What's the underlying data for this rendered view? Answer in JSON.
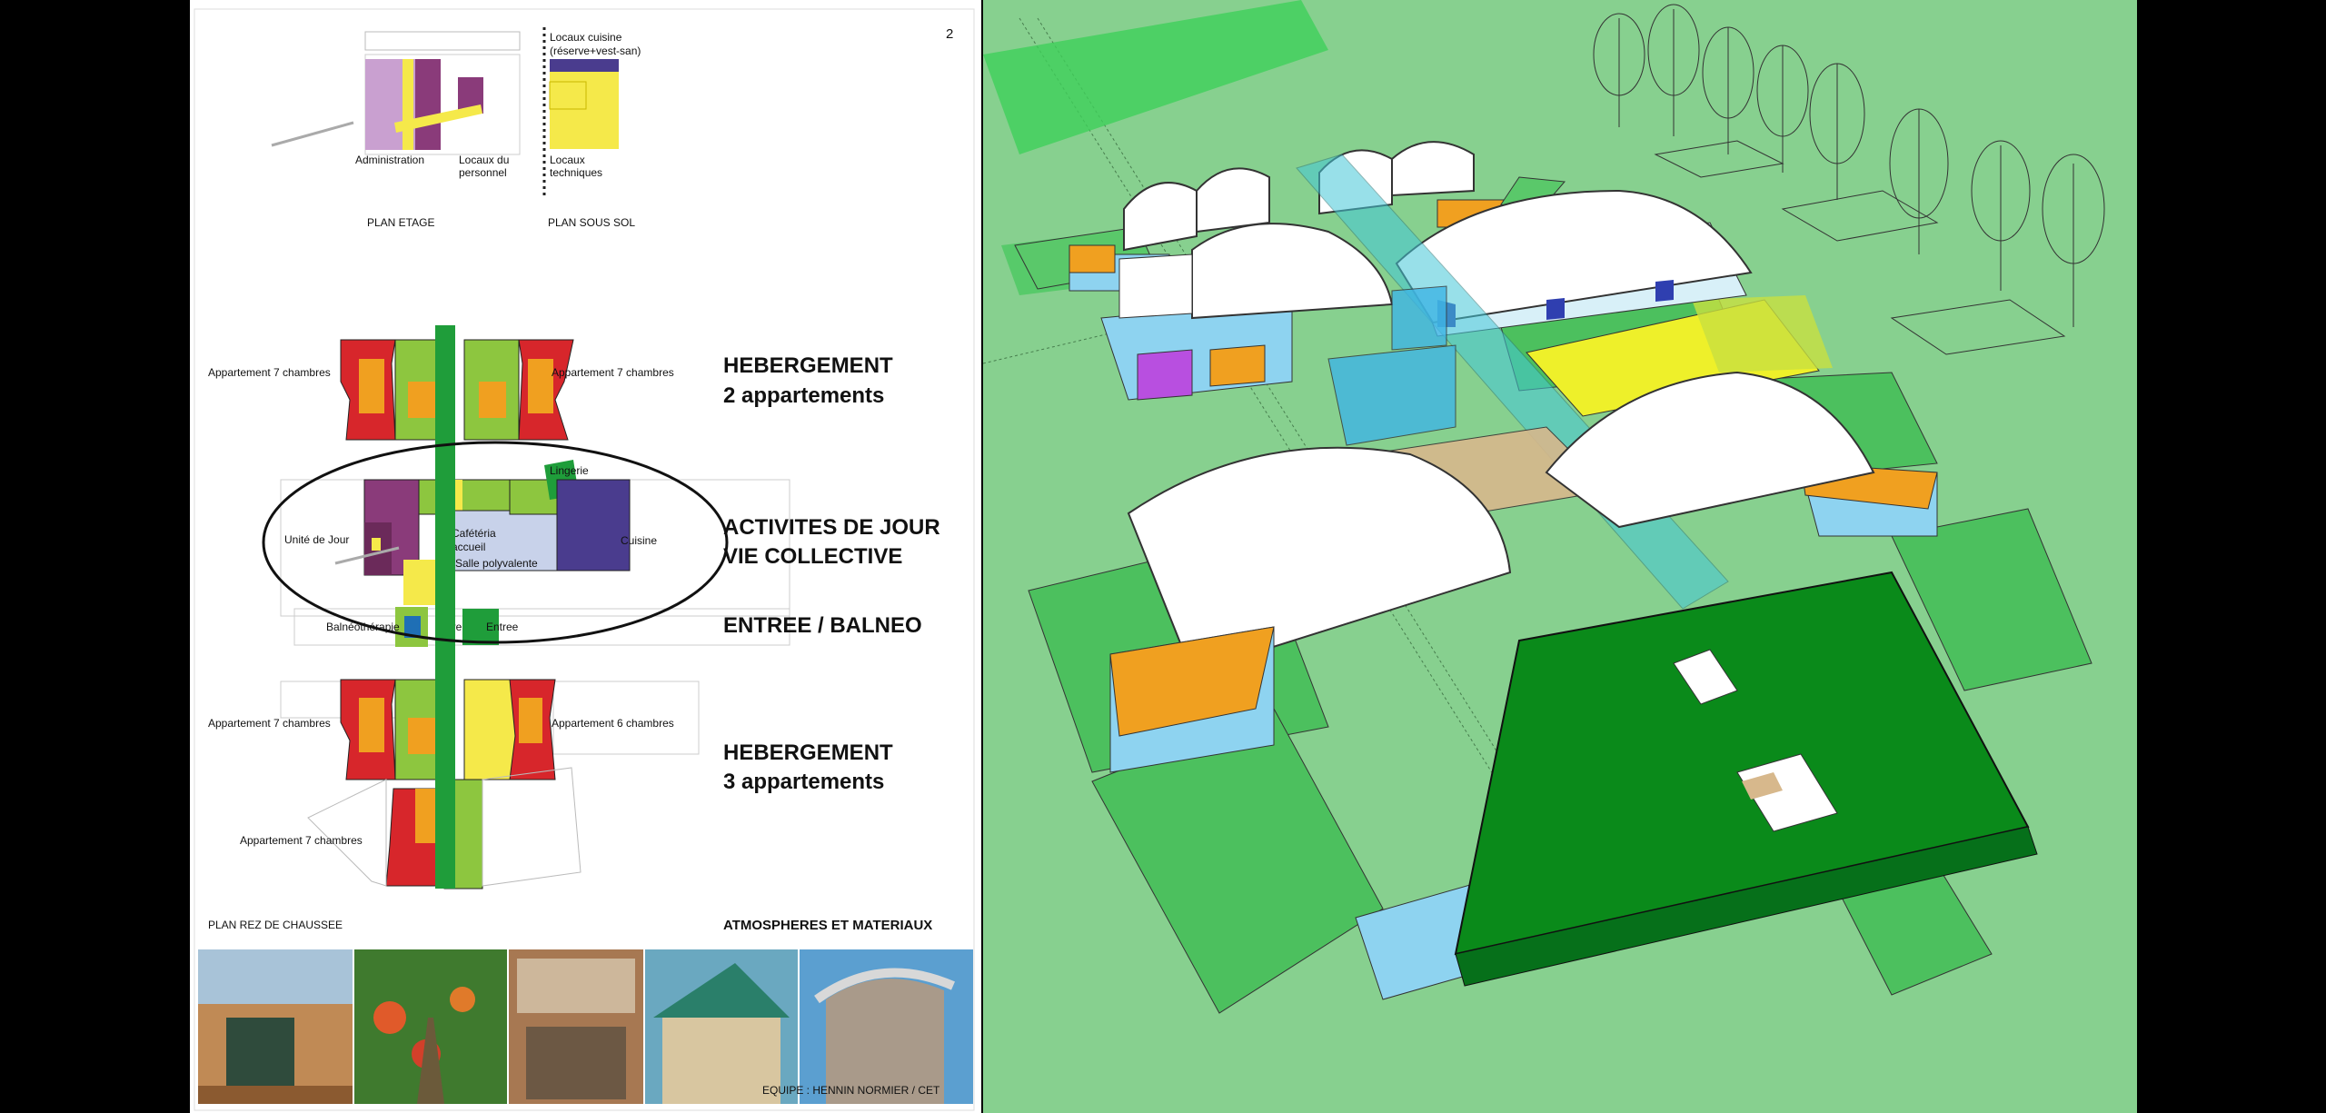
{
  "page_number": "2",
  "plans": {
    "etage": "PLAN ETAGE",
    "sous_sol": "PLAN SOUS SOL",
    "rez": "PLAN REZ DE CHAUSSEE"
  },
  "labels": {
    "administration": "Administration",
    "locaux_personnel_1": "Locaux du",
    "locaux_personnel_2": "personnel",
    "locaux_cuisine_1": "Locaux cuisine",
    "locaux_cuisine_2": "(réserve+vest-san)",
    "locaux_techniques_1": "Locaux",
    "locaux_techniques_2": "techniques",
    "appt7_tl": "Appartement 7 chambres",
    "appt7_tr": "Appartement 7 chambres",
    "unite_jour": "Unité de Jour",
    "lingerie": "Lingerie",
    "cafeteria": "Cafétéria",
    "accueil": "accueil",
    "salle": "Salle polyvalente",
    "cuisine": "Cuisine",
    "balneo": "Balnéothérapie",
    "serre": "Serre",
    "entree": "Entree",
    "appt7_bl": "Appartement 7 chambres",
    "appt6_br": "Appartement 6 chambres",
    "appt7_bottom": "Appartement 7 chambres"
  },
  "headings": {
    "heb1_a": "HEBERGEMENT",
    "heb1_b": "2 appartements",
    "act_a": "ACTIVITES DE JOUR",
    "act_b": "VIE COLLECTIVE",
    "entree": "ENTREE / BALNEO",
    "heb2_a": "HEBERGEMENT",
    "heb2_b": "3 appartements",
    "atmos": "ATMOSPHERES ET MATERIAUX"
  },
  "credit": "EQUIPE : HENNIN NORMIER / CET",
  "photos": [
    "wood-terrace",
    "greenhouse",
    "wood-facade",
    "green-roof",
    "curved-roof"
  ],
  "colors": {
    "red": "#d7262b",
    "orange": "#f0a020",
    "lime": "#8dc63f",
    "green": "#1f9d3a",
    "purple": "#8a3b7a",
    "violet": "#4a3c8e",
    "yellow": "#f5e94a",
    "ground": "#87d08f"
  }
}
